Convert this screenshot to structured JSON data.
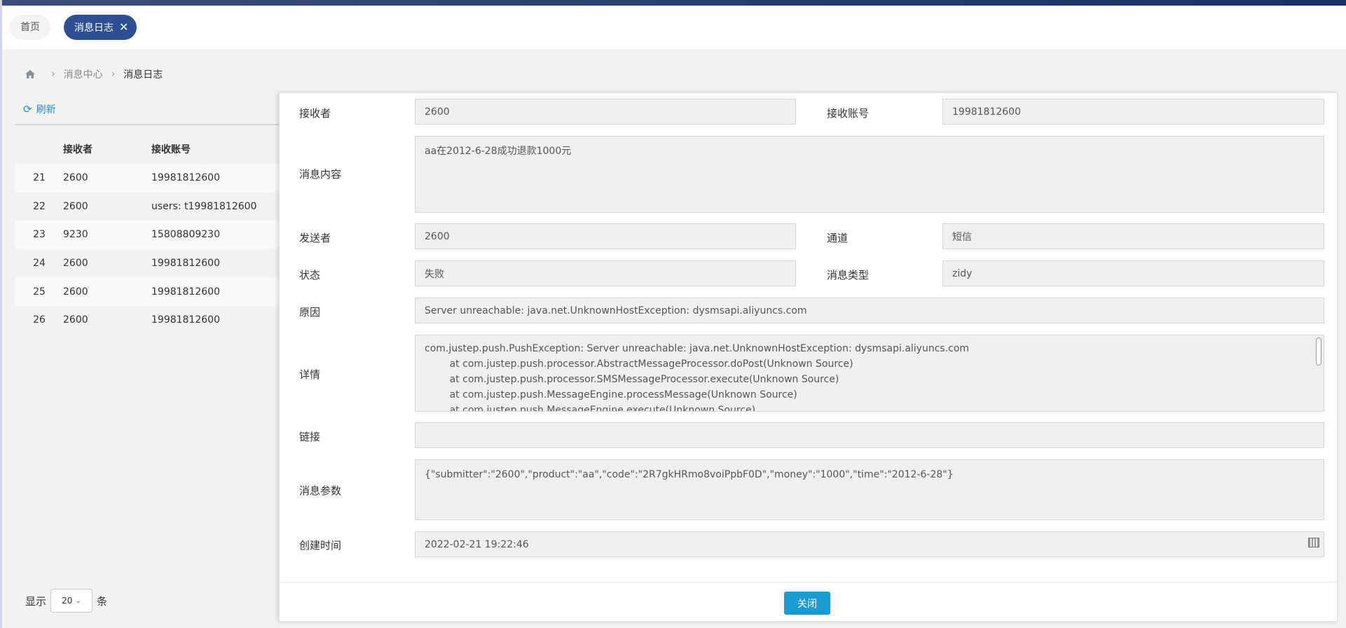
{
  "tabs": {
    "home": "首页",
    "active": "消息日志",
    "close_glyph": "✕"
  },
  "breadcrumb": {
    "level1": "消息中心",
    "current": "消息日志",
    "sep": "›"
  },
  "toolbar": {
    "refresh": "刷新"
  },
  "table": {
    "headers": [
      "",
      "接收者",
      "接收账号"
    ],
    "rows": [
      [
        "21",
        "2600",
        "19981812600"
      ],
      [
        "22",
        "2600",
        "users: t19981812600"
      ],
      [
        "23",
        "9230",
        "15808809230"
      ],
      [
        "24",
        "2600",
        "19981812600"
      ],
      [
        "25",
        "2600",
        "19981812600"
      ],
      [
        "26",
        "2600",
        "19981812600"
      ]
    ]
  },
  "pager": {
    "prefix": "显示",
    "value": "20",
    "suffix": "条"
  },
  "detail": {
    "receiver_label": "接收者",
    "receiver": "2600",
    "account_label": "接收账号",
    "account": "19981812600",
    "content_label": "消息内容",
    "content": "aa在2012-6-28成功退款1000元",
    "sender_label": "发送者",
    "sender": "2600",
    "channel_label": "通道",
    "channel": "短信",
    "status_label": "状态",
    "status": "失败",
    "type_label": "消息类型",
    "type": "zidy",
    "reason_label": "原因",
    "reason": "Server unreachable: java.net.UnknownHostException: dysmsapi.aliyuncs.com",
    "details_label": "详情",
    "details": "com.justep.push.PushException: Server unreachable: java.net.UnknownHostException: dysmsapi.aliyuncs.com\n        at com.justep.push.processor.AbstractMessageProcessor.doPost(Unknown Source)\n        at com.justep.push.processor.SMSMessageProcessor.execute(Unknown Source)\n        at com.justep.push.MessageEngine.processMessage(Unknown Source)\n        at com.justep.push.MessageEngine.execute(Unknown Source)",
    "link_label": "链接",
    "link": "",
    "params_label": "消息参数",
    "params": "{\"submitter\":\"2600\",\"product\":\"aa\",\"code\":\"2R7gkHRmo8voiPpbF0D\",\"money\":\"1000\",\"time\":\"2012-6-28\"}",
    "created_label": "创建时间",
    "created": "2022-02-21 19:22:46",
    "close_button": "关闭"
  }
}
